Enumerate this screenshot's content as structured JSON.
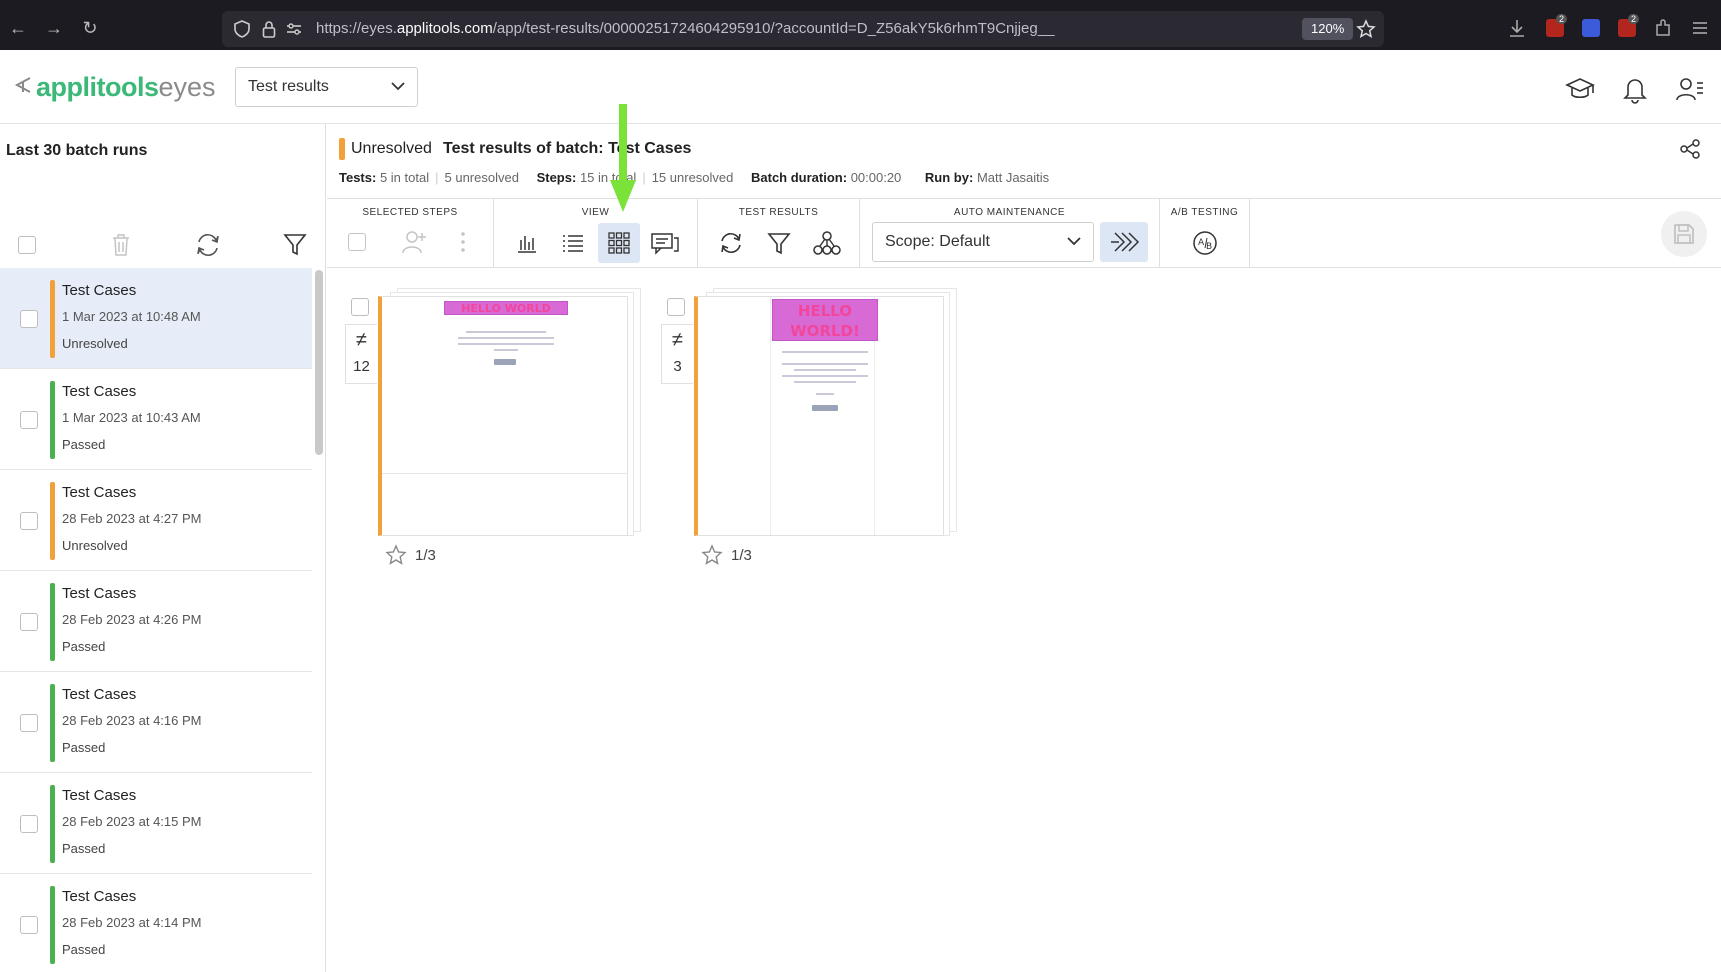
{
  "browser": {
    "url_prefix": "https://eyes.",
    "url_domain": "applitools.com",
    "url_path": "/app/test-results/00000251724604295910/?accountId=D_Z56akY5k6rhmT9Cnjjeg__",
    "zoom": "120%",
    "ext_badge_1": "2",
    "ext_badge_2": "2"
  },
  "header": {
    "logo_applitools": "applitools",
    "logo_eyes": "eyes",
    "view_select": "Test results",
    "icons": [
      "graduation-cap-icon",
      "bell-icon",
      "user-settings-icon"
    ]
  },
  "left": {
    "title": "Last 30 batch runs",
    "batches": [
      {
        "name": "Test Cases",
        "date": "1 Mar 2023 at 10:48 AM",
        "status": "Unresolved",
        "color": "#f0a13a",
        "selected": true
      },
      {
        "name": "Test Cases",
        "date": "1 Mar 2023 at 10:43 AM",
        "status": "Passed",
        "color": "#4caf50",
        "selected": false
      },
      {
        "name": "Test Cases",
        "date": "28 Feb 2023 at 4:27 PM",
        "status": "Unresolved",
        "color": "#f0a13a",
        "selected": false
      },
      {
        "name": "Test Cases",
        "date": "28 Feb 2023 at 4:26 PM",
        "status": "Passed",
        "color": "#4caf50",
        "selected": false
      },
      {
        "name": "Test Cases",
        "date": "28 Feb 2023 at 4:16 PM",
        "status": "Passed",
        "color": "#4caf50",
        "selected": false
      },
      {
        "name": "Test Cases",
        "date": "28 Feb 2023 at 4:15 PM",
        "status": "Passed",
        "color": "#4caf50",
        "selected": false
      },
      {
        "name": "Test Cases",
        "date": "28 Feb 2023 at 4:14 PM",
        "status": "Passed",
        "color": "#4caf50",
        "selected": false
      }
    ]
  },
  "batch": {
    "status": "Unresolved",
    "title_label": "Test results of batch:",
    "title_value": "Test Cases",
    "tests_label": "Tests:",
    "tests_total": "5 in total",
    "tests_unresolved": "5 unresolved",
    "steps_label": "Steps:",
    "steps_total": "15 in total",
    "steps_unresolved": "15 unresolved",
    "duration_label": "Batch duration:",
    "duration_value": "00:00:20",
    "runby_label": "Run by:",
    "runby_value": "Matt Jasaitis"
  },
  "toolbar": {
    "selected_steps": "SELECTED STEPS",
    "view": "VIEW",
    "test_results": "TEST RESULTS",
    "auto_maintenance": "AUTO MAINTENANCE",
    "ab_testing": "A/B TESTING",
    "scope": "Scope: Default"
  },
  "results": [
    {
      "diff_count": "12",
      "page": "1/3",
      "hello_text": "HELLO WORLD"
    },
    {
      "diff_count": "3",
      "page": "1/3",
      "hello_text": "HELLO WORLD!"
    }
  ],
  "colors": {
    "accent_green": "#3cb878",
    "unresolved": "#f0a13a",
    "passed": "#4caf50",
    "selected_row": "#e6edf8",
    "annotation_arrow": "#7be23a"
  }
}
